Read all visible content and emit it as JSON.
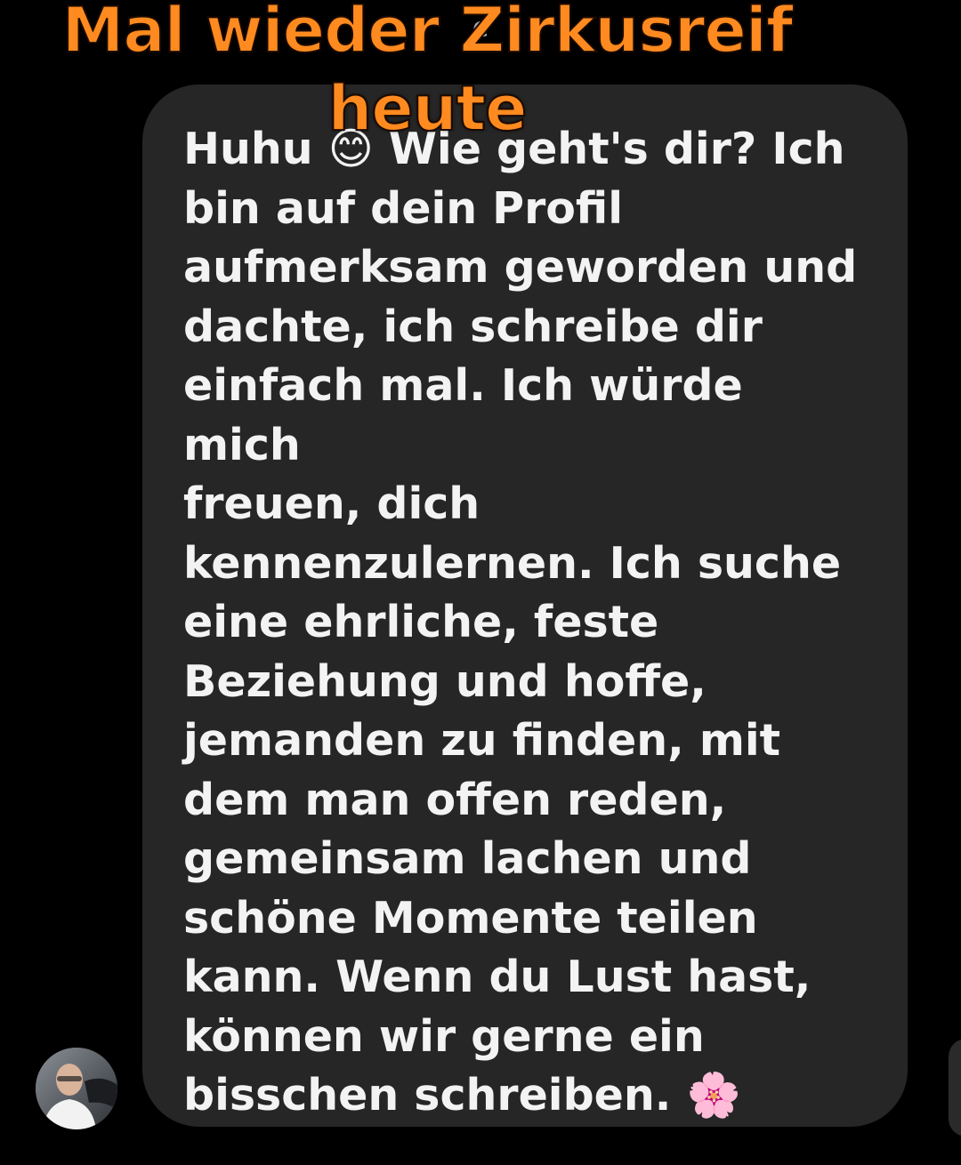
{
  "overlay_caption": {
    "line1": "Mal wieder Zirkusreif",
    "line2": "heute"
  },
  "obscured_header": "e",
  "message": {
    "lines": [
      "Huhu 😊 Wie geht's dir? Ich",
      "bin auf dein Profil",
      "aufmerksam geworden und",
      "dachte, ich schreibe dir",
      "einfach mal. Ich würde mich",
      "freuen, dich",
      "kennenzulernen. Ich suche",
      "eine ehrliche, feste",
      "Beziehung und hoffe,",
      "jemanden zu finden, mit",
      "dem man offen reden,",
      "gemeinsam lachen und",
      "schöne Momente teilen",
      "kann. Wenn du Lust hast,",
      "können wir gerne ein",
      "bisschen schreiben. 🌸"
    ]
  },
  "icons": {
    "avatar": "sender-avatar-photo",
    "emoji1": "smiling-face-icon",
    "emoji2": "cherry-blossom-icon"
  },
  "colors": {
    "background": "#000000",
    "bubble": "#262626",
    "message_text": "#f3f3f3",
    "caption": "#ff8a1f"
  }
}
